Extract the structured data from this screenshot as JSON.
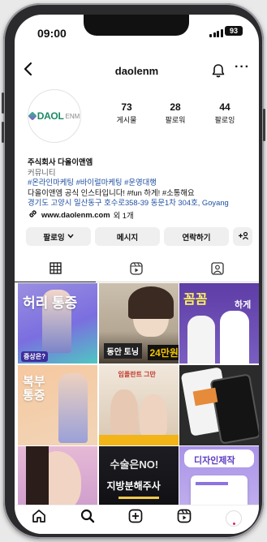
{
  "status_bar": {
    "time": "09:00",
    "battery": "93"
  },
  "header": {
    "username": "daolenm"
  },
  "profile": {
    "logo": {
      "text": "DAOL",
      "suffix": "ENM"
    },
    "stats": [
      {
        "value": "73",
        "label": "게시물"
      },
      {
        "value": "28",
        "label": "팔로워"
      },
      {
        "value": "44",
        "label": "팔로잉"
      }
    ],
    "name": "주식회사 다올이앤엠",
    "category": "커뮤니티",
    "hashtags": "#온라인마케팅 #바이럴마케팅 #운영대행",
    "description": "다올이앤엠 공식 인스타입니다! #fun 하게! #소통해요",
    "address": "경기도 고양시 일산동구 호수로358-39 동문1차 304호, Goyang",
    "link": {
      "url": "www.daolenm.com",
      "extra": "외 1개"
    }
  },
  "actions": {
    "following": "팔로잉",
    "message": "메시지",
    "contact": "연락하기",
    "add_person": "+ዐ"
  },
  "tabs": [
    "grid",
    "reels",
    "tagged"
  ],
  "grid_posts": [
    {
      "id": "p1",
      "title": "허리 통증",
      "sub": "증상은?"
    },
    {
      "id": "p2",
      "title": "24만원",
      "sub": "동안 토닝"
    },
    {
      "id": "p3",
      "title": "꼼꼼",
      "sub": "하게"
    },
    {
      "id": "p4",
      "title": "복부 통증",
      "sub": ""
    },
    {
      "id": "p5",
      "title": "임플란트 그만",
      "sub": ""
    },
    {
      "id": "p6",
      "title": "",
      "sub": ""
    },
    {
      "id": "p7",
      "title": "",
      "sub": ""
    },
    {
      "id": "p8",
      "title": "수술은NO!",
      "sub": "지방분해주사"
    },
    {
      "id": "p9",
      "title": "디자인제작",
      "sub": ""
    }
  ],
  "colors": {
    "link": "#1f4fa3",
    "button": "#efefef",
    "brand_green": "#1c8a66"
  },
  "bottom_nav": [
    "home-icon",
    "search-icon",
    "create-icon",
    "reels-icon",
    "profile-avatar"
  ]
}
